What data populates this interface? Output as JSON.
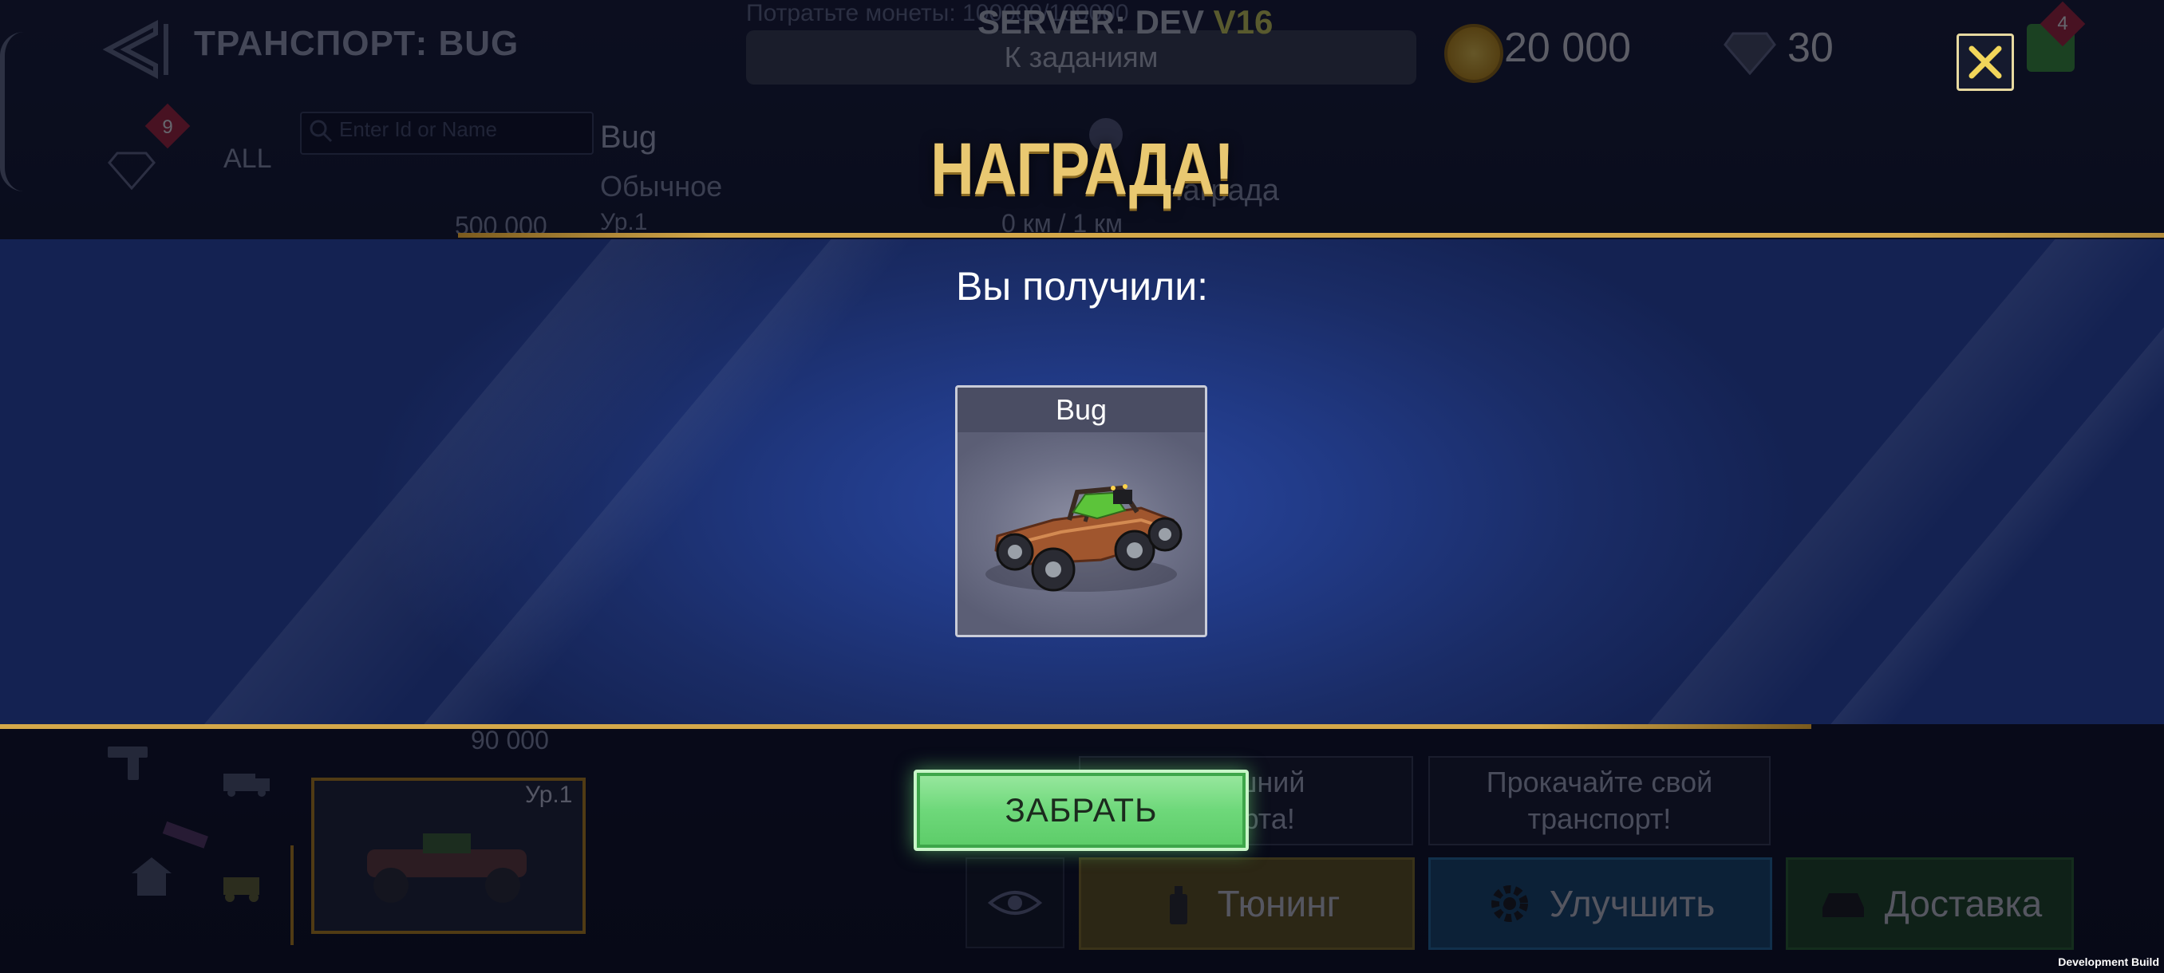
{
  "background": {
    "screen_title": "ТРАНСПОРТ: BUG",
    "search_placeholder": "Enter Id or Name",
    "filter_all": "ALL",
    "gem_badge_count": "9",
    "vehicle_name": "Bug",
    "vehicle_rarity": "Обычное",
    "vehicle_level": "Ур.1",
    "vehicle_price": "500 000",
    "list_price": "90 000",
    "mission_header": "Потратьте монеты: 100000/100000",
    "mission_button": "К заданиям",
    "server_label": "SERVER: DEV",
    "server_version": "V16",
    "coins": "20 000",
    "gems": "30",
    "plus_badge_count": "4",
    "award_label": "Награда",
    "distance": "0 км / 1 км",
    "card_level": "Ур.1",
    "hint_left": "внешний\nспорта!",
    "hint_right": "Прокачайте свой\nтранспорт!",
    "buttons": {
      "tuning": "Тюнинг",
      "upgrade": "Улучшить",
      "delivery": "Доставка"
    }
  },
  "reward": {
    "title": "НАГРАДА!",
    "received_label": "Вы получили:",
    "item_name": "Bug",
    "claim_button": "ЗАБРАТЬ"
  },
  "footer": {
    "build_label": "Development Build"
  },
  "colors": {
    "gold": "#e9c871",
    "banner_blue": "#213a86",
    "claim_green": "#6ed87a",
    "accent_line": "#d4a84a"
  },
  "icons": {
    "close": "close-icon",
    "back": "back-arrow-icon",
    "search": "search-icon",
    "diamond": "diamond-icon",
    "coin": "coin-icon",
    "eye": "eye-icon",
    "spray": "spray-can-icon",
    "gear": "gear-icon",
    "truck": "truck-icon",
    "home": "home-icon"
  }
}
